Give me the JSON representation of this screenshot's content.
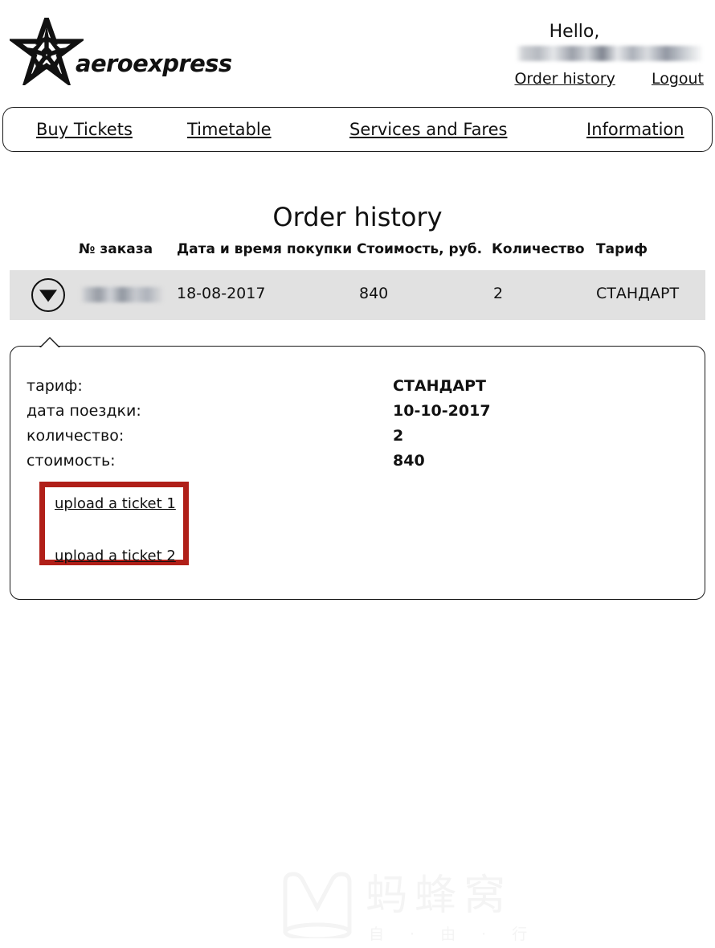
{
  "header": {
    "logo_word": "aeroexpress",
    "logo_icon": "aeroexpress-star-logo",
    "hello_text": "Hello,",
    "user_name_redacted": "",
    "links": [
      {
        "label": "Order history",
        "name": "order-history-link"
      },
      {
        "label": "Logout",
        "name": "logout-link"
      }
    ]
  },
  "nav": {
    "items": [
      {
        "label": "Buy Tickets",
        "name": "nav-buy-tickets"
      },
      {
        "label": "Timetable",
        "name": "nav-timetable"
      },
      {
        "label": "Services and Fares",
        "name": "nav-services-and-fares"
      },
      {
        "label": "Information",
        "name": "nav-information"
      }
    ]
  },
  "page": {
    "title": "Order history"
  },
  "orders_table": {
    "columns": [
      "№ заказа",
      "Дата и время покупки",
      "Стоимость, руб.",
      "Количество",
      "Тариф"
    ],
    "row": {
      "toggle_icon": "triangle-down-icon",
      "order_number_redacted": "",
      "purchase_date": "18-08-2017",
      "price": "840",
      "quantity": "2",
      "fare": "СТАНДАРТ"
    }
  },
  "detail_panel": {
    "rows": [
      {
        "label": "тариф:",
        "value": "СТАНДАРТ"
      },
      {
        "label": "дата поездки:",
        "value": "10-10-2017"
      },
      {
        "label": "количество:",
        "value": "2"
      },
      {
        "label": "стоимость:",
        "value": "840"
      }
    ],
    "upload_links": [
      {
        "label": "upload a ticket 1",
        "name": "upload-ticket-1-link"
      },
      {
        "label": "upload a ticket 2",
        "name": "upload-ticket-2-link"
      }
    ],
    "highlight_color": "#b01f18"
  },
  "watermark": {
    "text_main": "蚂蜂窝",
    "text_sub": "自 · 由 · 行",
    "color": "#f4f4f4"
  },
  "colors": {
    "row_background": "#e1e1e1",
    "border": "#1a1a1a",
    "text": "#111111"
  }
}
